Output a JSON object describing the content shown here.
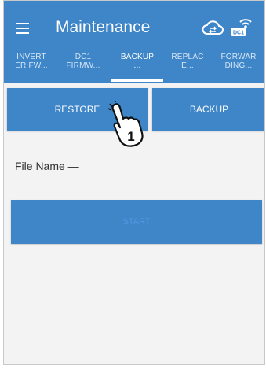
{
  "header": {
    "title": "Maintenance",
    "menu_icon": "hamburger-menu-icon",
    "cloud_icon": "cloud-sync-icon",
    "dc1_icon": "dc1-wifi-icon",
    "dc1_label": "DC1"
  },
  "tabs": [
    {
      "line1": "INVERT",
      "line2": "ER FW..."
    },
    {
      "line1": "DC1",
      "line2": "FIRMW..."
    },
    {
      "line1": "BACKUP",
      "line2": "..."
    },
    {
      "line1": "REPLAC",
      "line2": "E..."
    },
    {
      "line1": "FORWAR",
      "line2": "DING..."
    }
  ],
  "active_tab_index": 2,
  "buttons": {
    "restore": "RESTORE",
    "backup": "BACKUP",
    "start": "START"
  },
  "file_name_label": "File Name —",
  "callout": {
    "number": "1",
    "icon": "tap-hand-icon"
  },
  "colors": {
    "accent": "#3f86c9",
    "background": "#f3f3f3"
  }
}
